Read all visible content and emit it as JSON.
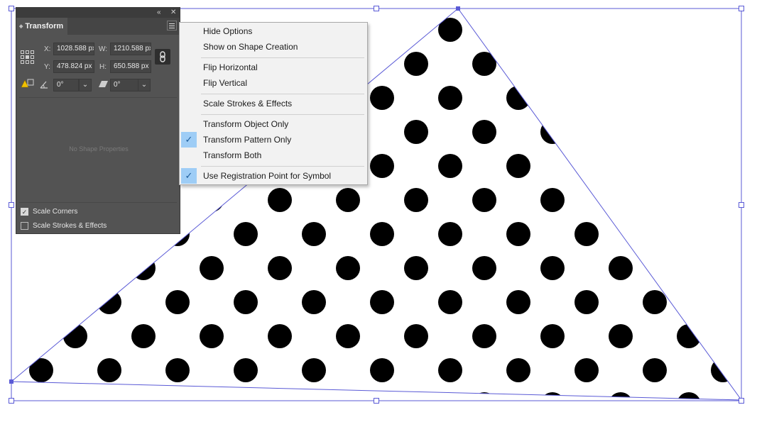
{
  "panel": {
    "tab_label": "Transform",
    "x_label": "X:",
    "x_value": "1028.588 px",
    "w_label": "W:",
    "w_value": "1210.588 px",
    "y_label": "Y:",
    "y_value": "478.824 px",
    "h_label": "H:",
    "h_value": "650.588 px",
    "rotate_value": "0°",
    "shear_value": "0°",
    "no_shape_text": "No Shape Properties",
    "scale_corners_label": "Scale Corners",
    "scale_corners_checked": true,
    "scale_strokes_label": "Scale Strokes & Effects",
    "scale_strokes_checked": false
  },
  "menu": {
    "items": [
      {
        "label": "Hide Options",
        "checked": false
      },
      {
        "label": "Show on Shape Creation",
        "checked": false
      },
      {
        "label": "Flip Horizontal",
        "checked": false
      },
      {
        "label": "Flip Vertical",
        "checked": false
      },
      {
        "label": "Scale Strokes & Effects",
        "checked": false
      },
      {
        "label": "Transform Object Only",
        "checked": false
      },
      {
        "label": "Transform Pattern Only",
        "checked": true
      },
      {
        "label": "Transform Both",
        "checked": false
      },
      {
        "label": "Use Registration Point for Symbol",
        "checked": true
      }
    ]
  },
  "colors": {
    "selection": "#5a5ad6",
    "panel_bg": "#535353",
    "menu_check_bg": "#9ecdf6",
    "pattern_dot": "#000000"
  }
}
